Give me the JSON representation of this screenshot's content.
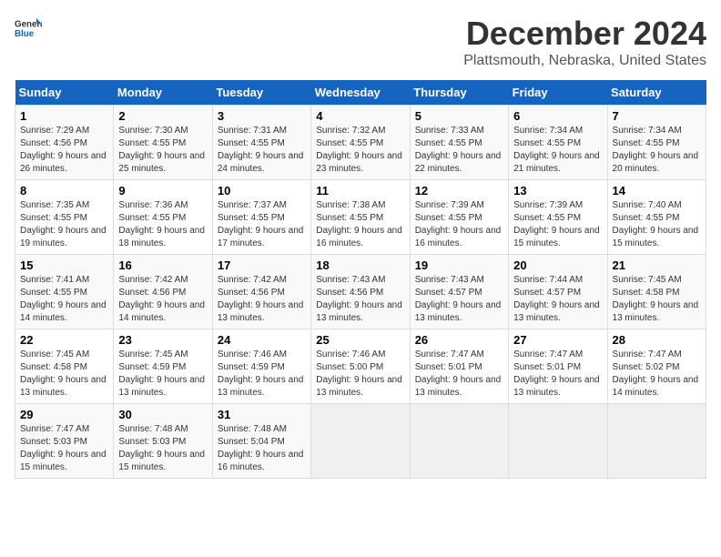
{
  "logo": {
    "text_general": "General",
    "text_blue": "Blue"
  },
  "title": "December 2024",
  "subtitle": "Plattsmouth, Nebraska, United States",
  "days_of_week": [
    "Sunday",
    "Monday",
    "Tuesday",
    "Wednesday",
    "Thursday",
    "Friday",
    "Saturday"
  ],
  "weeks": [
    [
      {
        "day": "1",
        "sunrise": "7:29 AM",
        "sunset": "4:56 PM",
        "daylight": "9 hours and 26 minutes."
      },
      {
        "day": "2",
        "sunrise": "7:30 AM",
        "sunset": "4:55 PM",
        "daylight": "9 hours and 25 minutes."
      },
      {
        "day": "3",
        "sunrise": "7:31 AM",
        "sunset": "4:55 PM",
        "daylight": "9 hours and 24 minutes."
      },
      {
        "day": "4",
        "sunrise": "7:32 AM",
        "sunset": "4:55 PM",
        "daylight": "9 hours and 23 minutes."
      },
      {
        "day": "5",
        "sunrise": "7:33 AM",
        "sunset": "4:55 PM",
        "daylight": "9 hours and 22 minutes."
      },
      {
        "day": "6",
        "sunrise": "7:34 AM",
        "sunset": "4:55 PM",
        "daylight": "9 hours and 21 minutes."
      },
      {
        "day": "7",
        "sunrise": "7:34 AM",
        "sunset": "4:55 PM",
        "daylight": "9 hours and 20 minutes."
      }
    ],
    [
      {
        "day": "8",
        "sunrise": "7:35 AM",
        "sunset": "4:55 PM",
        "daylight": "9 hours and 19 minutes."
      },
      {
        "day": "9",
        "sunrise": "7:36 AM",
        "sunset": "4:55 PM",
        "daylight": "9 hours and 18 minutes."
      },
      {
        "day": "10",
        "sunrise": "7:37 AM",
        "sunset": "4:55 PM",
        "daylight": "9 hours and 17 minutes."
      },
      {
        "day": "11",
        "sunrise": "7:38 AM",
        "sunset": "4:55 PM",
        "daylight": "9 hours and 16 minutes."
      },
      {
        "day": "12",
        "sunrise": "7:39 AM",
        "sunset": "4:55 PM",
        "daylight": "9 hours and 16 minutes."
      },
      {
        "day": "13",
        "sunrise": "7:39 AM",
        "sunset": "4:55 PM",
        "daylight": "9 hours and 15 minutes."
      },
      {
        "day": "14",
        "sunrise": "7:40 AM",
        "sunset": "4:55 PM",
        "daylight": "9 hours and 15 minutes."
      }
    ],
    [
      {
        "day": "15",
        "sunrise": "7:41 AM",
        "sunset": "4:55 PM",
        "daylight": "9 hours and 14 minutes."
      },
      {
        "day": "16",
        "sunrise": "7:42 AM",
        "sunset": "4:56 PM",
        "daylight": "9 hours and 14 minutes."
      },
      {
        "day": "17",
        "sunrise": "7:42 AM",
        "sunset": "4:56 PM",
        "daylight": "9 hours and 13 minutes."
      },
      {
        "day": "18",
        "sunrise": "7:43 AM",
        "sunset": "4:56 PM",
        "daylight": "9 hours and 13 minutes."
      },
      {
        "day": "19",
        "sunrise": "7:43 AM",
        "sunset": "4:57 PM",
        "daylight": "9 hours and 13 minutes."
      },
      {
        "day": "20",
        "sunrise": "7:44 AM",
        "sunset": "4:57 PM",
        "daylight": "9 hours and 13 minutes."
      },
      {
        "day": "21",
        "sunrise": "7:45 AM",
        "sunset": "4:58 PM",
        "daylight": "9 hours and 13 minutes."
      }
    ],
    [
      {
        "day": "22",
        "sunrise": "7:45 AM",
        "sunset": "4:58 PM",
        "daylight": "9 hours and 13 minutes."
      },
      {
        "day": "23",
        "sunrise": "7:45 AM",
        "sunset": "4:59 PM",
        "daylight": "9 hours and 13 minutes."
      },
      {
        "day": "24",
        "sunrise": "7:46 AM",
        "sunset": "4:59 PM",
        "daylight": "9 hours and 13 minutes."
      },
      {
        "day": "25",
        "sunrise": "7:46 AM",
        "sunset": "5:00 PM",
        "daylight": "9 hours and 13 minutes."
      },
      {
        "day": "26",
        "sunrise": "7:47 AM",
        "sunset": "5:01 PM",
        "daylight": "9 hours and 13 minutes."
      },
      {
        "day": "27",
        "sunrise": "7:47 AM",
        "sunset": "5:01 PM",
        "daylight": "9 hours and 13 minutes."
      },
      {
        "day": "28",
        "sunrise": "7:47 AM",
        "sunset": "5:02 PM",
        "daylight": "9 hours and 14 minutes."
      }
    ],
    [
      {
        "day": "29",
        "sunrise": "7:47 AM",
        "sunset": "5:03 PM",
        "daylight": "9 hours and 15 minutes."
      },
      {
        "day": "30",
        "sunrise": "7:48 AM",
        "sunset": "5:03 PM",
        "daylight": "9 hours and 15 minutes."
      },
      {
        "day": "31",
        "sunrise": "7:48 AM",
        "sunset": "5:04 PM",
        "daylight": "9 hours and 16 minutes."
      },
      null,
      null,
      null,
      null
    ]
  ],
  "labels": {
    "sunrise": "Sunrise:",
    "sunset": "Sunset:",
    "daylight": "Daylight:"
  }
}
